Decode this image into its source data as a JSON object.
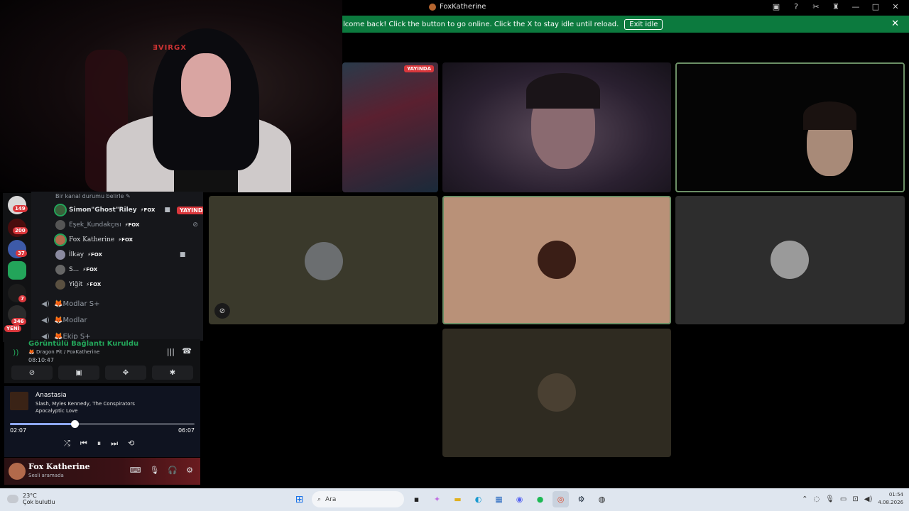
{
  "window": {
    "title": "FoxKatherine"
  },
  "banner": {
    "message": "lcome back! Click the button to go online. Click the X to stay idle until reload.",
    "button": "Exit idle"
  },
  "stream_overlay_logo": "ƎVIRGX",
  "server_rail": [
    {
      "badge": "149"
    },
    {
      "badge": "200"
    },
    {
      "badge": "37"
    },
    {
      "badge": ""
    },
    {
      "badge": "7"
    },
    {
      "badge": "346"
    }
  ],
  "server_rail_new": "YENİ",
  "channel": {
    "status_placeholder": "Bir kanal durumu belirle",
    "members": [
      {
        "name": "Simon\"Ghost\"Riley",
        "tag": "⚡FOX",
        "live": "YAYINDA"
      },
      {
        "name": "Eşek_Kundakçısı",
        "tag": "⚡FOX"
      },
      {
        "name": "Fox Katherine",
        "tag": "⚡FOX"
      },
      {
        "name": "İlkay",
        "tag": "⚡FOX"
      },
      {
        "name": "S...",
        "tag": "⚡FOX"
      },
      {
        "name": "Yiğit",
        "tag": "⚡FOX"
      }
    ],
    "voice_channels": [
      {
        "name": "🦊Modlar S+"
      },
      {
        "name": "🦊Modlar"
      },
      {
        "name": "🦊Ekip S+"
      }
    ]
  },
  "voice": {
    "connected": "Görüntülü Bağlantı Kuruldu",
    "channel_path": "🦊 Dragon Pit / FoxKatherine",
    "elapsed": "08:10:47"
  },
  "music": {
    "song": "Anastasia",
    "artists": "Slash, Myles Kennedy, The Conspirators",
    "album": "Apocalyptic Love",
    "current": "02:07",
    "duration": "06:07",
    "progress": 0.35
  },
  "user": {
    "name": "Fox Katherine",
    "status": "Sesli aramada"
  },
  "grid": {
    "live_label": "YAYINDA"
  },
  "taskbar": {
    "temperature": "23°C",
    "weather": "Çok bulutlu",
    "search_placeholder": "Ara",
    "time": "01:54",
    "date": "4.08.2026"
  },
  "colors": {
    "accent_green": "#0c7a3e",
    "live_red": "#da373c",
    "speaking_outline": "#6c8f66"
  }
}
